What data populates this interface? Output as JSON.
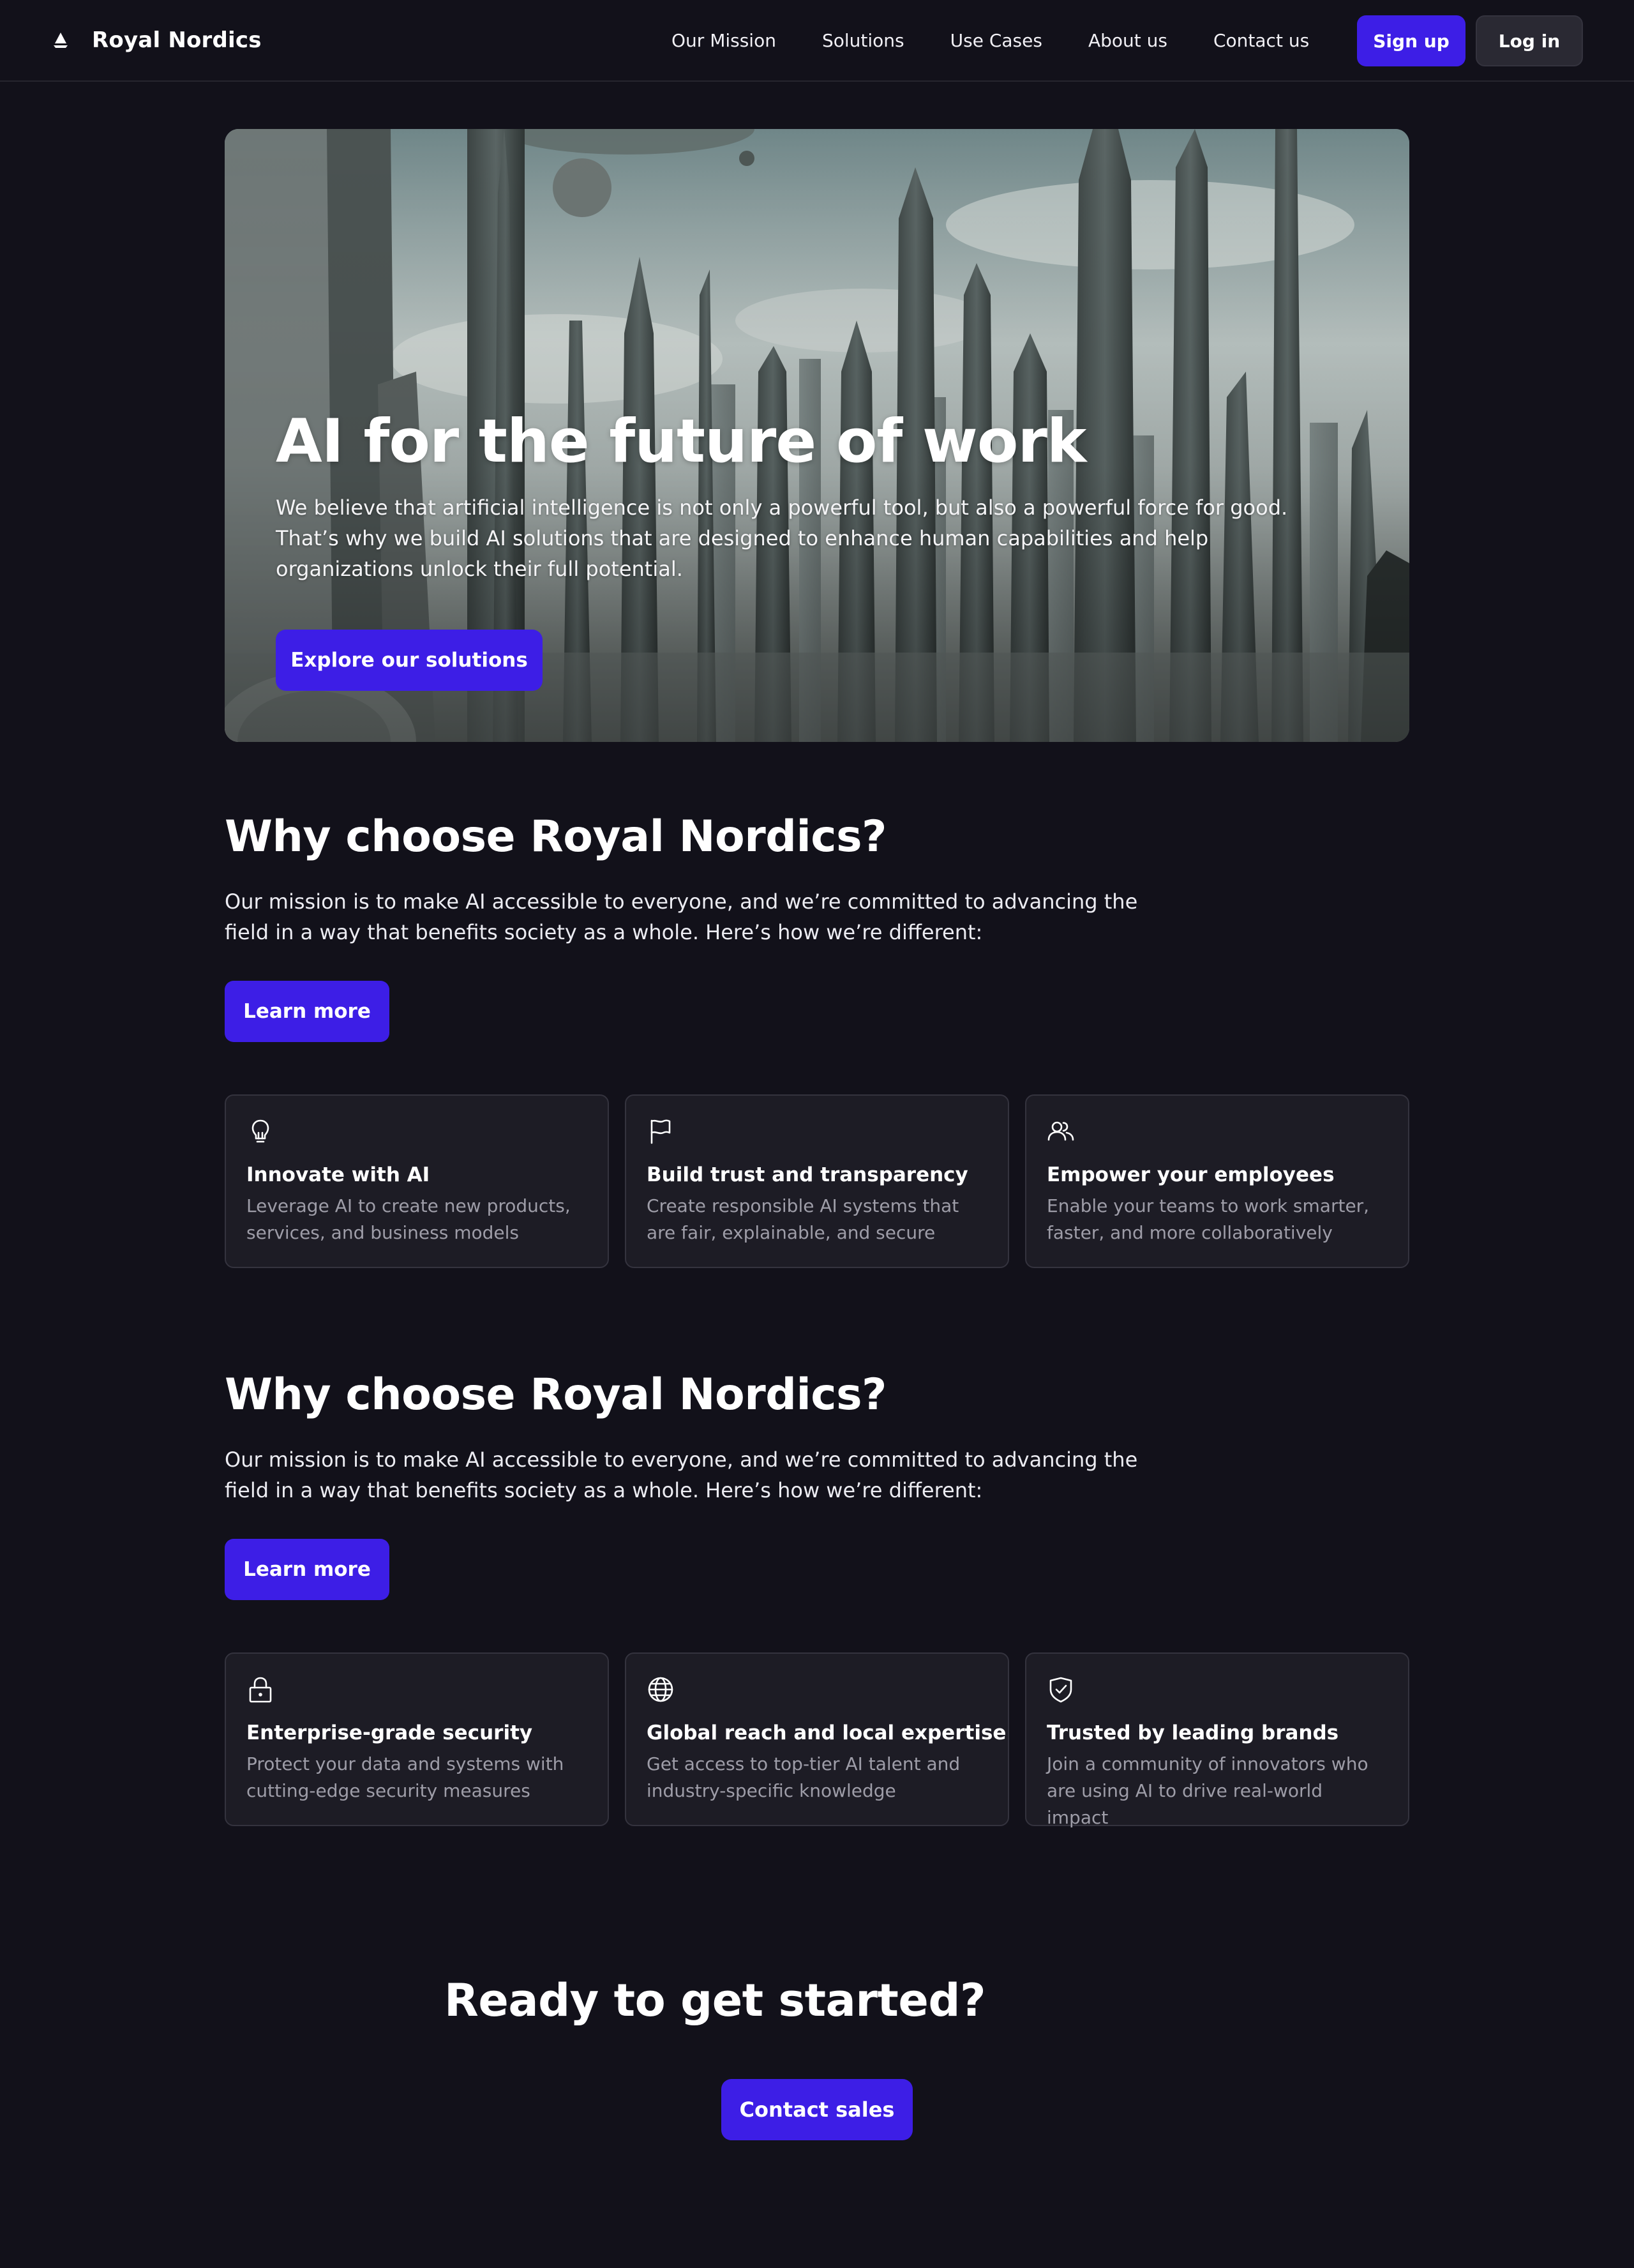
{
  "brand": {
    "name": "Royal Nordics",
    "icon": "sailboat-logo-icon"
  },
  "nav": {
    "links": [
      "Our Mission",
      "Solutions",
      "Use Cases",
      "About us",
      "Contact us"
    ],
    "signup_label": "Sign up",
    "login_label": "Log in"
  },
  "hero": {
    "title": "AI for the future of work",
    "subtitle": "We believe that artificial intelligence is not only a powerful tool, but also a powerful force for good. That’s why we build AI solutions that are designed to enhance human capabilities and help organizations unlock their full potential.",
    "cta_label": "Explore our solutions",
    "image": "futuristic-city-skyline"
  },
  "sections": [
    {
      "title": "Why choose Royal Nordics?",
      "text": "Our mission is to make AI accessible to everyone, and we’re committed to advancing the field in a way that benefits society as a whole. Here’s how we’re different:",
      "button_label": "Learn more",
      "cards": [
        {
          "icon": "lightbulb-icon",
          "title": "Innovate with AI",
          "desc": "Leverage AI to create new products, services, and business models"
        },
        {
          "icon": "flag-icon",
          "title": "Build trust and transparency",
          "desc": "Create responsible AI systems that are fair, explainable, and secure"
        },
        {
          "icon": "users-icon",
          "title": "Empower your employees",
          "desc": "Enable your teams to work smarter, faster, and more collaboratively"
        }
      ]
    },
    {
      "title": "Why choose Royal Nordics?",
      "text": "Our mission is to make AI accessible to everyone, and we’re committed to advancing the field in a way that benefits society as a whole. Here’s how we’re different:",
      "button_label": "Learn more",
      "cards": [
        {
          "icon": "lock-icon",
          "title": "Enterprise-grade security",
          "desc": "Protect your data and systems with cutting-edge security measures"
        },
        {
          "icon": "globe-icon",
          "title": "Global reach and local expertise",
          "desc": "Get access to top-tier AI talent and industry-specific knowledge"
        },
        {
          "icon": "shield-check-icon",
          "title": "Trusted by leading brands",
          "desc": "Join a community of innovators who are using AI to drive real-world impact"
        }
      ]
    }
  ],
  "cta": {
    "title": "Ready to get started?",
    "button_label": "Contact sales"
  },
  "colors": {
    "background": "#12111a",
    "accent": "#3d1ee6",
    "card": "#1d1c25",
    "muted_text": "#9e9da8"
  }
}
